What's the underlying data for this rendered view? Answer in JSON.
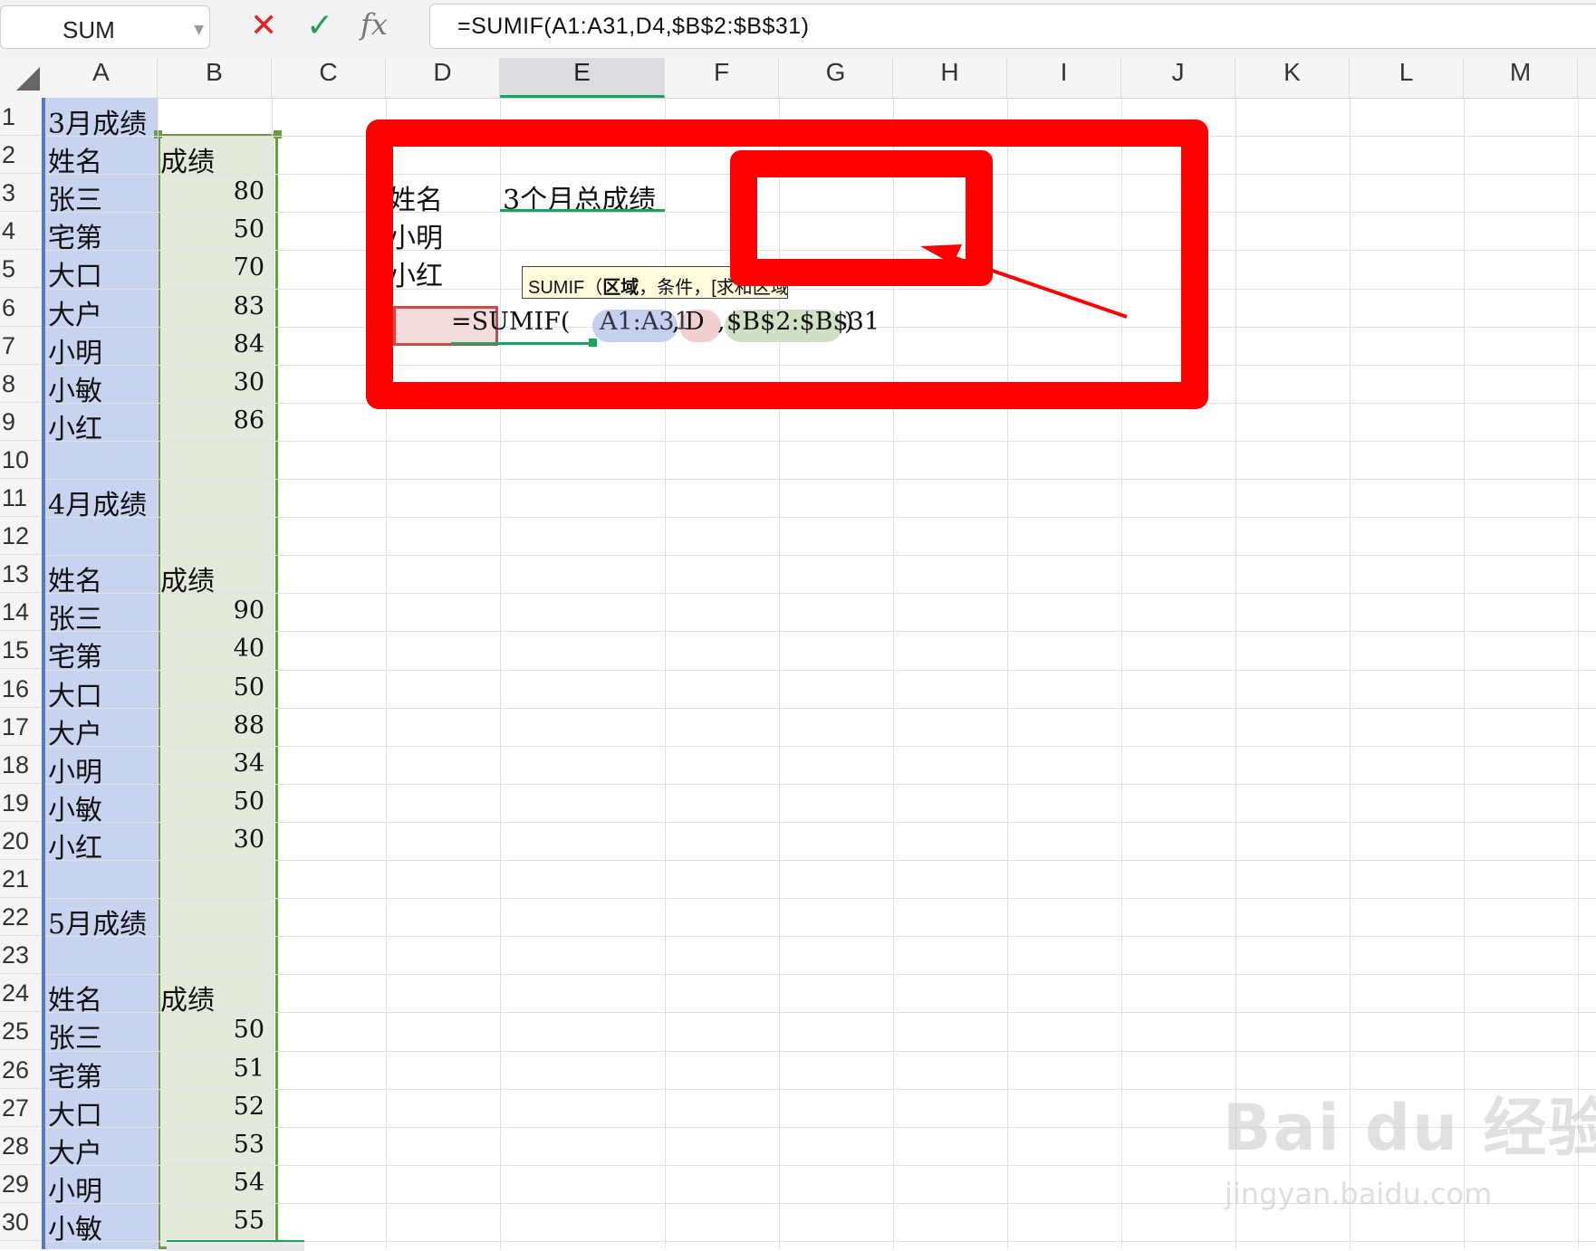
{
  "formula_bar": {
    "name_box": "SUM",
    "fx_label": "fx",
    "formula": "=SUMIF(A1:A31,D4,$B$2:$B$31)"
  },
  "columns": [
    "A",
    "B",
    "C",
    "D",
    "E",
    "F",
    "G",
    "H",
    "I",
    "J",
    "K",
    "L",
    "M"
  ],
  "rows": [
    "1",
    "2",
    "3",
    "4",
    "5",
    "6",
    "7",
    "8",
    "9",
    "10",
    "11",
    "12",
    "13",
    "14",
    "15",
    "16",
    "17",
    "18",
    "19",
    "20",
    "21",
    "22",
    "23",
    "24",
    "25",
    "26",
    "27",
    "28",
    "29",
    "30"
  ],
  "colA": [
    "3月成绩",
    "姓名",
    "张三",
    "宅第",
    "大口",
    "大户",
    "小明",
    "小敏",
    "小红",
    "",
    "4月成绩",
    "",
    "姓名",
    "张三",
    "宅第",
    "大口",
    "大户",
    "小明",
    "小敏",
    "小红",
    "",
    "5月成绩",
    "",
    "姓名",
    "张三",
    "宅第",
    "大口",
    "大户",
    "小明",
    "小敏"
  ],
  "colB": [
    "",
    "成绩",
    "80",
    "50",
    "70",
    "83",
    "84",
    "30",
    "86",
    "",
    "",
    "",
    "成绩",
    "90",
    "40",
    "50",
    "88",
    "34",
    "50",
    "30",
    "",
    "",
    "",
    "成绩",
    "50",
    "51",
    "52",
    "53",
    "54",
    "55"
  ],
  "colD": {
    "r3": "姓名",
    "r4": "小明",
    "r5": "小红"
  },
  "colE": {
    "r3": "3个月总成绩"
  },
  "edit_cell": {
    "prefix": "=SUMIF(",
    "arg1": "A1:A31",
    "sep1": ",",
    "arg2": "D",
    "sep2": ",",
    "arg3": "$B$2:$B$31",
    "suffix": ")"
  },
  "tooltip": {
    "fn": "SUMIF",
    "open": "（",
    "arg_bold": "区域",
    "rest": "，条件，[求和区域]"
  },
  "watermark": {
    "brand": "Bai du 经验",
    "url": "jingyan.baidu.com"
  },
  "colors": {
    "annotation": "#ff0000",
    "accent": "#1aa35f",
    "rangeA": "#c8d3f0",
    "rangeB": "#e3eadb"
  }
}
